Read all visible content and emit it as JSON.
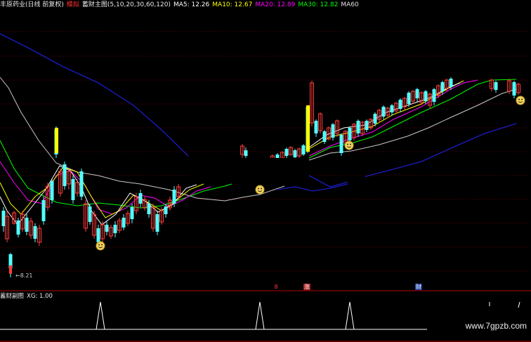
{
  "header": {
    "stock_name": "丰原药业(日线 前复权)",
    "mode": "模拟",
    "indicator": "蓄财主图(5,10,20,30,60,120)",
    "ma_items": [
      {
        "label": "MA5: 12.26",
        "color": "#ffffff"
      },
      {
        "label": "MA10: 12.67",
        "color": "#ffff00"
      },
      {
        "label": "MA20: 12.89",
        "color": "#ff00ff"
      },
      {
        "label": "MA30: 12.82",
        "color": "#00ff00"
      },
      {
        "label": "MA60",
        "color": "#e0e0e0"
      }
    ]
  },
  "main_chart": {
    "low_price_label": "8.21"
  },
  "signal_tags": [
    {
      "text": "8",
      "color": "#ff3333"
    },
    {
      "text": "涨",
      "color": "#ffffff",
      "bg": "#aa2020"
    },
    {
      "text": "财",
      "color": "#ffffff",
      "bg": "#2040a0"
    }
  ],
  "sub_chart": {
    "title": "蓄财副图",
    "xg_label": "XG: 1.00"
  },
  "watermark": "www.7gpzb.com",
  "colors": {
    "up": "#ff3c3c",
    "down": "#54ffff",
    "ma5": "#ffffff",
    "ma10": "#ffff00",
    "ma20": "#ff00ff",
    "ma30": "#00ff00",
    "ma60": "#c8c8c8",
    "ma120": "#1c1cc8",
    "grid": "#7a0000"
  }
}
